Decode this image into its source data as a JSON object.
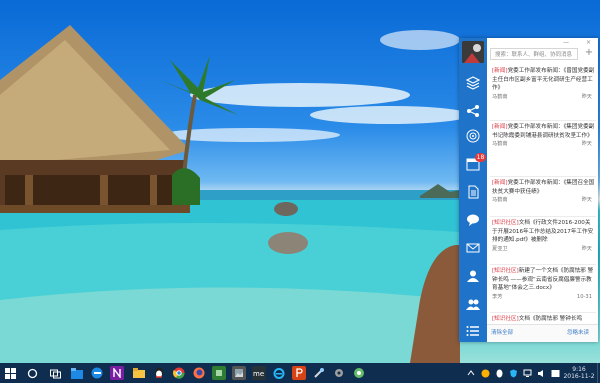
{
  "panel": {
    "search_placeholder": "搜索：联系人、群组、协同消息",
    "feed": [
      {
        "tag": "[新闻]",
        "text": "党委工作部发布新闻：《曾国党委副主任白市区副乡富平无化调研生产经营工作》",
        "author": "马鹤南",
        "time": "昨天"
      },
      {
        "tag": "[新闻]",
        "text": "党委工作部发布新闻：《集团党委副书记陈霞委到铺港县调研扶贫攻坚工作》",
        "author": "马鹤南",
        "time": "昨天"
      },
      {
        "tag": "[新闻]",
        "text": "党委工作部发布新闻：《集团召全国扶贫大赛中获佳绩》",
        "author": "马鹤南",
        "time": "昨天"
      },
      {
        "tag": "[知识社区]",
        "text": "文档《行政文件2016-200关于开展2016年工作总结及2017年工作安排的通知.pdf》被删除",
        "author": "夏亚卫",
        "time": "昨天"
      },
      {
        "tag": "[知识社区]",
        "text": "新建了一个文档《防腐怯邪 警钟长鸣 ——参观“云南省反腐倡廉警示教育基地”体会之三.docx》",
        "author": "李芳",
        "time": "10-31"
      },
      {
        "tag": "[知识社区]",
        "text": "文档《防腐怯邪 警钟长鸣",
        "author": "",
        "time": ""
      }
    ],
    "footer": {
      "clear_all": "清除全部",
      "ignore_unread": "忽略未读"
    },
    "rail_badge": "18",
    "rail_icons": [
      "layers-icon",
      "share-icon",
      "target-icon",
      "calendar-icon",
      "document-icon",
      "chat-icon",
      "mail-icon",
      "contacts-icon",
      "group-icon",
      "list-icon"
    ],
    "window_controls": {
      "minimize": "—",
      "close": "×"
    },
    "add_label": "+"
  },
  "taskbar": {
    "time": "9:16",
    "date": "2016-11-2",
    "apps": [
      "windows-icon",
      "search-icon",
      "task-view-icon",
      "file-explorer-icon",
      "edge-icon",
      "onenote-icon",
      "folder-icon",
      "qq-icon",
      "chrome-icon",
      "firefox-icon",
      "green-app-icon",
      "photos-icon",
      "mail-app-icon",
      "ie-icon",
      "powerpoint-icon",
      "tool-icon",
      "settings-icon",
      "app-icon"
    ]
  },
  "colors": {
    "rail": "#1f74c9",
    "tag": "#d9363e",
    "taskbar": "#0f2e4f"
  }
}
